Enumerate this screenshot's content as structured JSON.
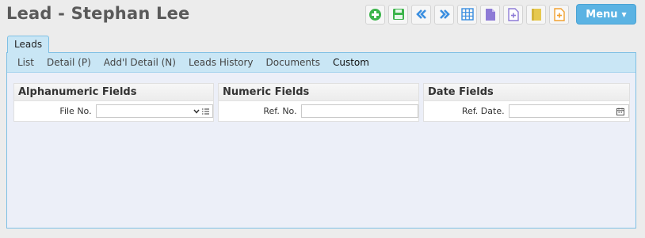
{
  "title": "Lead - Stephan Lee",
  "toolbar": {
    "buttons": [
      "add-icon",
      "save-icon",
      "first-record-icon",
      "previous-record-icon",
      "grid-view-icon",
      "document-icon",
      "add-document-icon",
      "notes-icon",
      "add-note-icon"
    ],
    "menu_label": "Menu"
  },
  "panel_tab": "Leads",
  "subnav": {
    "list": "List",
    "detail": "Detail (P)",
    "addl_detail": "Add'l Detail (N)",
    "history": "Leads History",
    "documents": "Documents",
    "custom": "Custom"
  },
  "sections": {
    "alpha": {
      "title": "Alphanumeric Fields",
      "label": "File No.",
      "value": ""
    },
    "numeric": {
      "title": "Numeric Fields",
      "label": "Ref. No.",
      "value": ""
    },
    "date": {
      "title": "Date Fields",
      "label": "Ref. Date.",
      "value": ""
    }
  },
  "colors": {
    "accent": "#5bb3e3",
    "tab_bg": "#c9e6f5",
    "panel_border": "#7fc0e4",
    "panel_bg": "#eceff8",
    "green": "#3cb44b",
    "blue": "#3a8ee0",
    "purple": "#8e7bd6",
    "yellow": "#e6c84e",
    "orange": "#f0a030"
  }
}
